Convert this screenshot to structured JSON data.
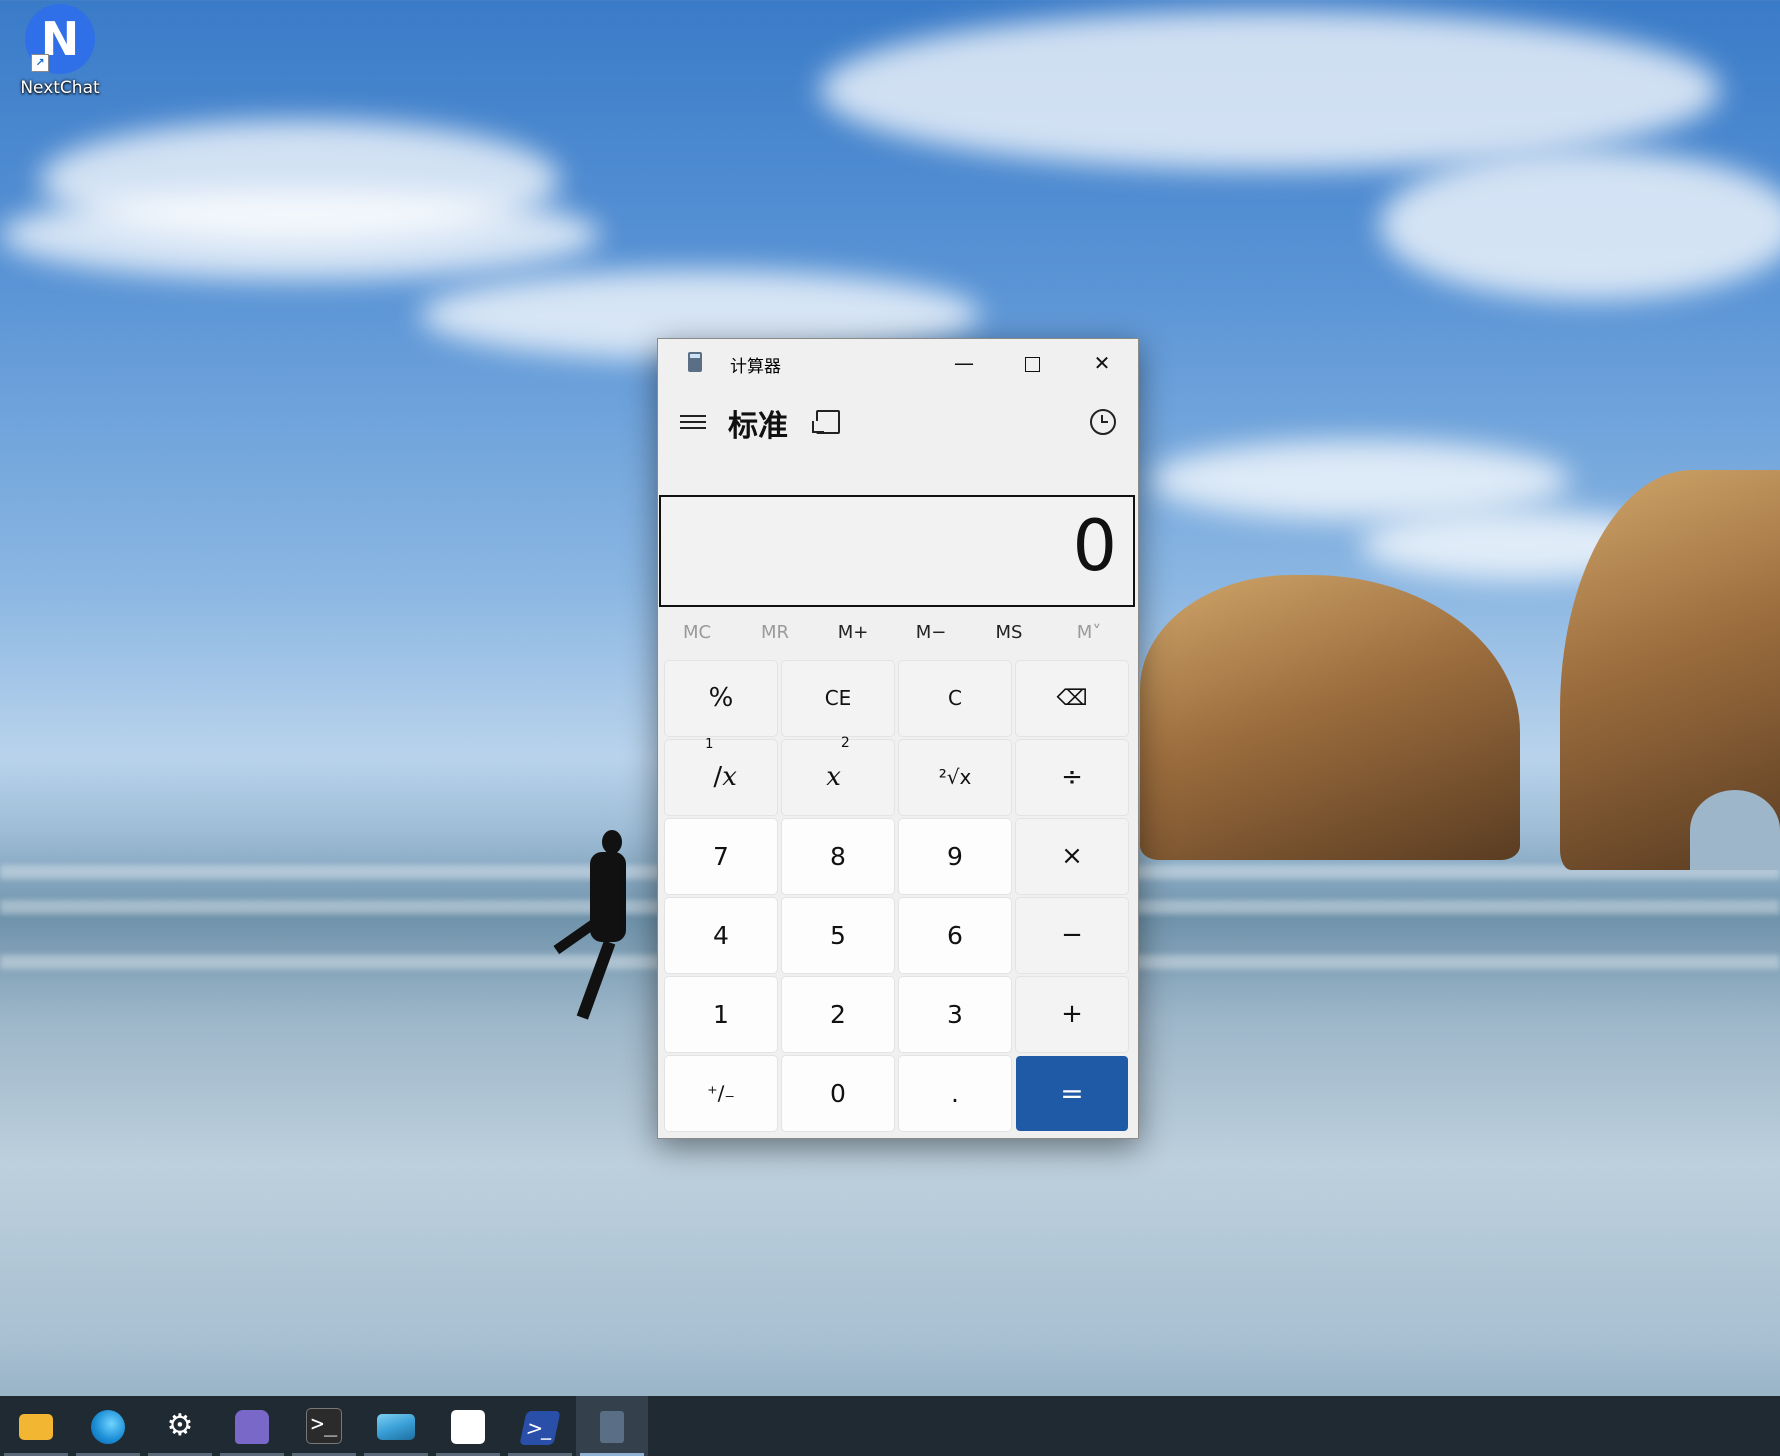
{
  "desktop": {
    "icons": [
      {
        "label": "NextChat",
        "icon": "nextchat-icon"
      }
    ]
  },
  "calculator": {
    "window_title": "计算器",
    "mode_title": "标准",
    "display_value": "0",
    "memory_buttons": [
      {
        "label": "MC",
        "enabled": false
      },
      {
        "label": "MR",
        "enabled": false
      },
      {
        "label": "M+",
        "enabled": true
      },
      {
        "label": "M−",
        "enabled": true
      },
      {
        "label": "MS",
        "enabled": true
      },
      {
        "label": "M˅",
        "enabled": false
      }
    ],
    "keys": {
      "percent": "%",
      "ce": "CE",
      "c": "C",
      "backspace": "⌫",
      "reciprocal_num": "1",
      "reciprocal_den": "x",
      "square_base": "x",
      "square_exp": "2",
      "sqrt": "²√x",
      "divide": "÷",
      "seven": "7",
      "eight": "8",
      "nine": "9",
      "multiply": "×",
      "four": "4",
      "five": "5",
      "six": "6",
      "minus": "−",
      "one": "1",
      "two": "2",
      "three": "3",
      "plus": "+",
      "negate": "⁺∕₋",
      "zero": "0",
      "decimal": ".",
      "equals": "="
    },
    "accent_color": "#1f5aa6"
  },
  "taskbar": {
    "apps": [
      {
        "name": "file-explorer",
        "color": "#f2b632"
      },
      {
        "name": "edge",
        "color": "#1d8fd6"
      },
      {
        "name": "settings",
        "color": "#ffffff"
      },
      {
        "name": "cat-app",
        "color": "#7a68c8"
      },
      {
        "name": "terminal",
        "color": "#2b2b2b"
      },
      {
        "name": "photos",
        "color": "#3aa0d8"
      },
      {
        "name": "store",
        "color": "#ffffff"
      },
      {
        "name": "powershell",
        "color": "#2a4fa8"
      },
      {
        "name": "calculator",
        "color": "#5a6f86",
        "active": true
      }
    ]
  }
}
